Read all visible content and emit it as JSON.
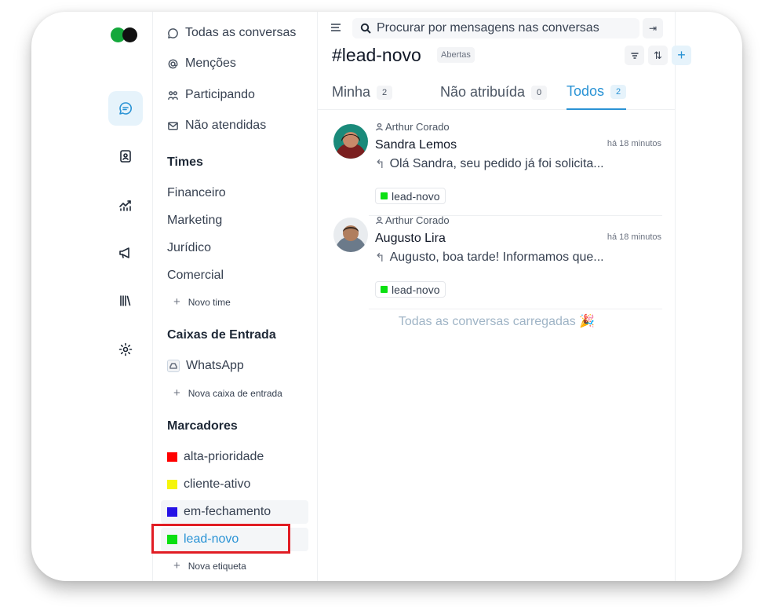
{
  "nav": {
    "all_conversations": "Todas as conversas",
    "mentions": "Menções",
    "participating": "Participando",
    "unattended": "Não atendidas"
  },
  "teams": {
    "title": "Times",
    "items": [
      "Financeiro",
      "Marketing",
      "Jurídico",
      "Comercial"
    ],
    "new_label": "Novo time"
  },
  "inboxes": {
    "title": "Caixas de Entrada",
    "items": [
      {
        "name": "WhatsApp",
        "icon": "inbox-icon"
      }
    ],
    "new_label": "Nova caixa de entrada"
  },
  "labels": {
    "title": "Marcadores",
    "items": [
      {
        "name": "alta-prioridade",
        "color": "#ff0000"
      },
      {
        "name": "cliente-ativo",
        "color": "#f5f50a"
      },
      {
        "name": "em-fechamento",
        "color": "#2512e6"
      },
      {
        "name": "lead-novo",
        "color": "#0be012"
      }
    ],
    "new_label": "Nova etiqueta",
    "active": "lead-novo"
  },
  "search": {
    "placeholder": "Procurar por mensagens nas conversas"
  },
  "header": {
    "title": "#lead-novo",
    "status": "Abertas"
  },
  "tabs": [
    {
      "label": "Minha",
      "count": "2"
    },
    {
      "label": "Não atribuída",
      "count": "0"
    },
    {
      "label": "Todos",
      "count": "2"
    }
  ],
  "conversations": [
    {
      "assignee": "Arthur Corado",
      "name": "Sandra Lemos",
      "time": "há 18 minutos",
      "message": "Olá Sandra, seu pedido já foi solicita...",
      "tag": "lead-novo"
    },
    {
      "assignee": "Arthur Corado",
      "name": "Augusto Lira",
      "time": "há 18 minutos",
      "message": "Augusto, boa tarde! Informamos que...",
      "tag": "lead-novo"
    }
  ],
  "footer": {
    "all_loaded": "Todas as conversas carregadas 🎉"
  },
  "colors": {
    "accent": "#2a93d5",
    "highlight_border": "#e11d24",
    "logo_green": "#14a83b"
  }
}
